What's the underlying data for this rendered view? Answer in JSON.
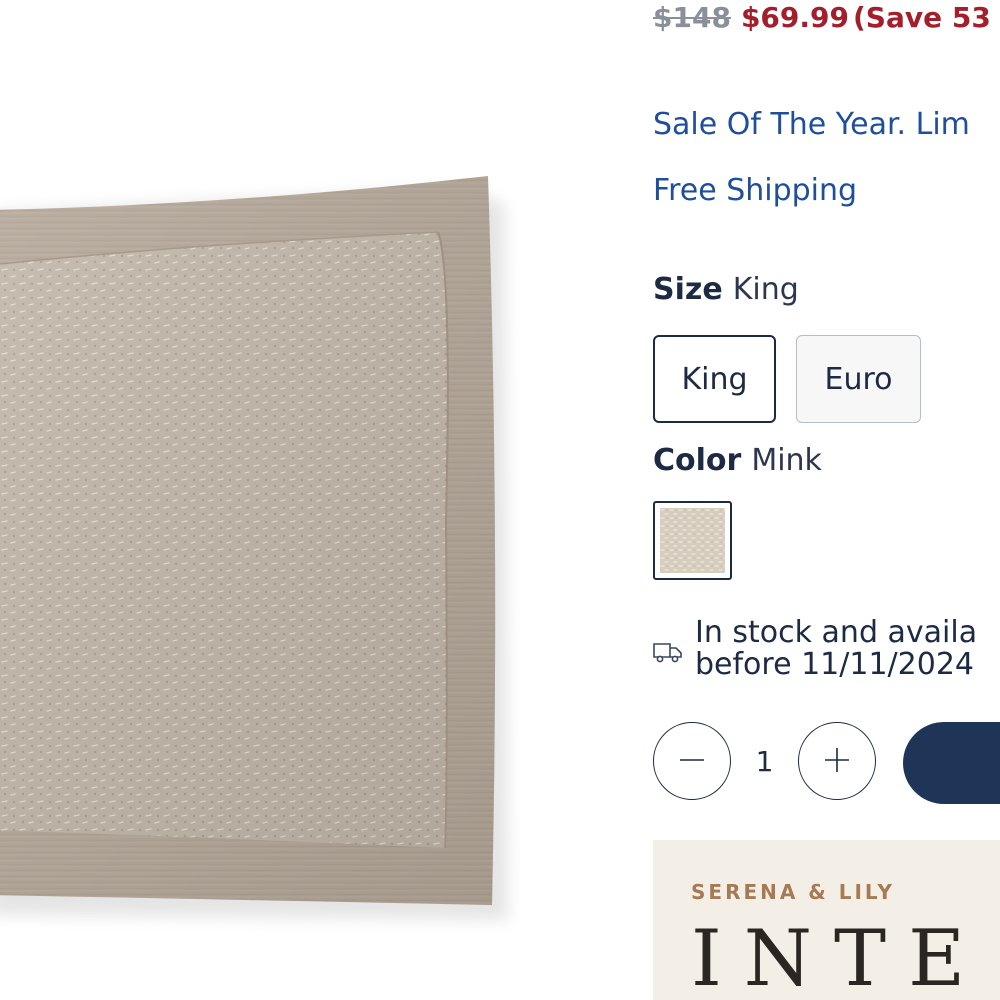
{
  "pricing": {
    "original_price": "$148",
    "sale_price": "$69.99",
    "savings": "(Save 53"
  },
  "promo": {
    "sale_text": "Sale Of The Year. Lim",
    "shipping_text": "Free Shipping"
  },
  "size": {
    "label": "Size",
    "selected": "King",
    "options": [
      "King",
      "Euro"
    ]
  },
  "color": {
    "label": "Color",
    "selected": "Mink",
    "swatch_color": "#d6cdbf"
  },
  "availability": {
    "line1": "In stock and availa",
    "line2": "before 11/11/2024",
    "icon": "truck-icon"
  },
  "quantity": {
    "value": "1",
    "decrease_icon": "minus-icon",
    "increase_icon": "plus-icon"
  },
  "ad": {
    "brand": "SERENA & LILY",
    "heading": "INTE"
  },
  "colors": {
    "navy": "#1d2a44",
    "sale_red": "#a31f2b",
    "promo_blue": "#1f4f9c",
    "cart_button": "#1f3557",
    "pillow_flange": "#b3a698",
    "pillow_body": "#c1b6a8",
    "ad_background": "#f4efe6"
  }
}
